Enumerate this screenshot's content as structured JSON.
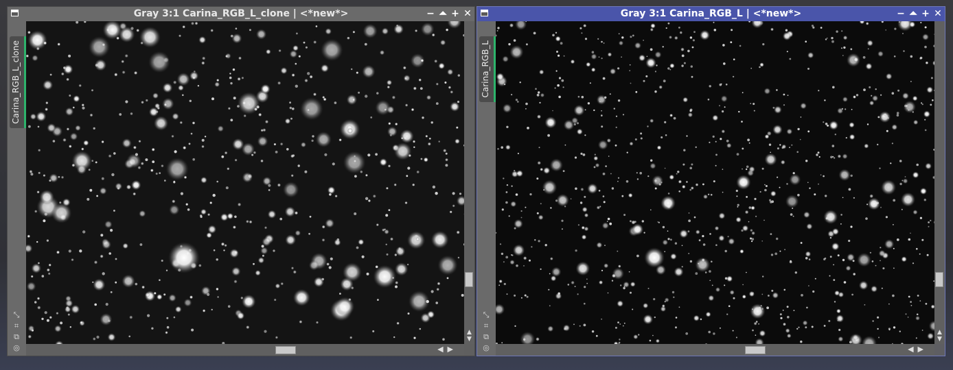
{
  "windows": [
    {
      "title": "Gray 3:1 Carina_RGB_L_clone | <*new*>",
      "tab_label": "Carina_RGB_L_clone",
      "active": false,
      "view_icon": "starfield-image",
      "buttons": [
        "minimize-icon",
        "shade-icon",
        "maximize-icon",
        "close-icon"
      ]
    },
    {
      "title": "Gray 3:1 Carina_RGB_L | <*new*>",
      "tab_label": "Carina_RGB_L",
      "active": true,
      "view_icon": "starfield-image",
      "buttons": [
        "minimize-icon",
        "shade-icon",
        "maximize-icon",
        "close-icon"
      ]
    }
  ],
  "icons": {
    "minimize": "−",
    "shade": "⏶",
    "maximize": "+",
    "close": "✕",
    "scroll_up": "▲",
    "scroll_down": "▼",
    "scroll_left": "◀",
    "scroll_right": "▶",
    "resize": "⤡",
    "fit": "⌗",
    "clone": "⧉",
    "lock": "◎"
  },
  "colors": {
    "active_title": "#4a55aa",
    "inactive_title": "#6a6a6a",
    "tab_indicator": "#2db36b"
  }
}
